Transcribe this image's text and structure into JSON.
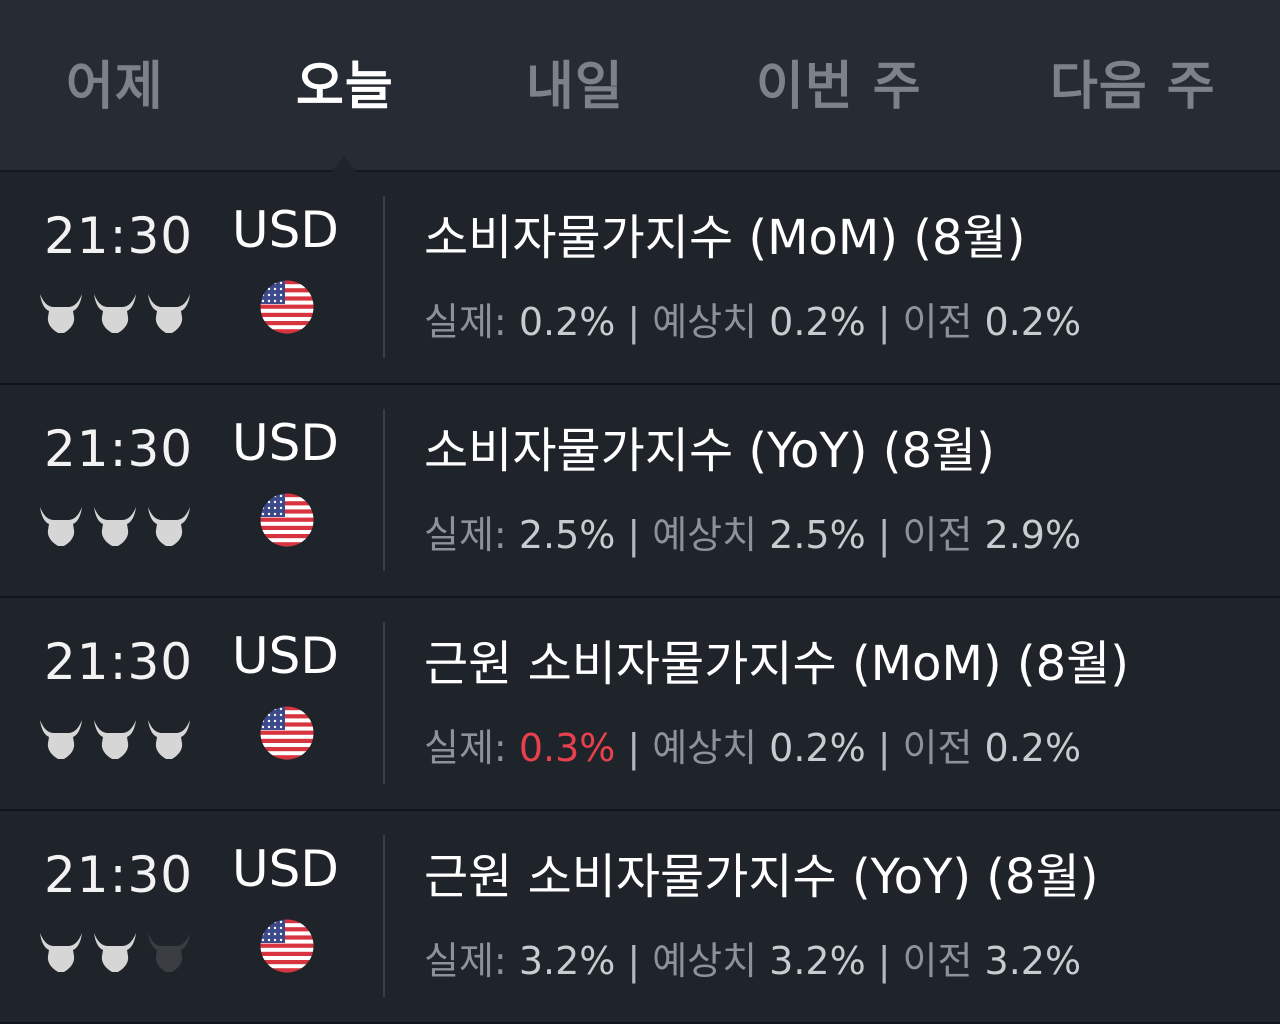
{
  "tabs": [
    {
      "label": "어제",
      "active": false
    },
    {
      "label": "오늘",
      "active": true
    },
    {
      "label": "내일",
      "active": false
    },
    {
      "label": "이번 주",
      "active": false
    },
    {
      "label": "다음 주",
      "active": false
    }
  ],
  "labels": {
    "actual": "실제:",
    "forecast": "예상치",
    "previous": "이전",
    "separator": "|"
  },
  "colors": {
    "bull_active": "#d6d6d6",
    "bull_inactive": "#3a3d42",
    "highlight_red": "#e8414d"
  },
  "events": [
    {
      "time": "21:30",
      "currency": "USD",
      "flag": "us-flag-icon",
      "importance": 3,
      "title": "소비자물가지수 (MoM) (8월)",
      "actual": "0.2%",
      "actual_highlight": false,
      "forecast": "0.2%",
      "previous": "0.2%"
    },
    {
      "time": "21:30",
      "currency": "USD",
      "flag": "us-flag-icon",
      "importance": 3,
      "title": "소비자물가지수 (YoY) (8월)",
      "actual": "2.5%",
      "actual_highlight": false,
      "forecast": "2.5%",
      "previous": "2.9%"
    },
    {
      "time": "21:30",
      "currency": "USD",
      "flag": "us-flag-icon",
      "importance": 3,
      "title": "근원 소비자물가지수 (MoM) (8월)",
      "actual": "0.3%",
      "actual_highlight": true,
      "forecast": "0.2%",
      "previous": "0.2%"
    },
    {
      "time": "21:30",
      "currency": "USD",
      "flag": "us-flag-icon",
      "importance": 2,
      "title": "근원 소비자물가지수 (YoY) (8월)",
      "actual": "3.2%",
      "actual_highlight": false,
      "forecast": "3.2%",
      "previous": "3.2%"
    }
  ]
}
